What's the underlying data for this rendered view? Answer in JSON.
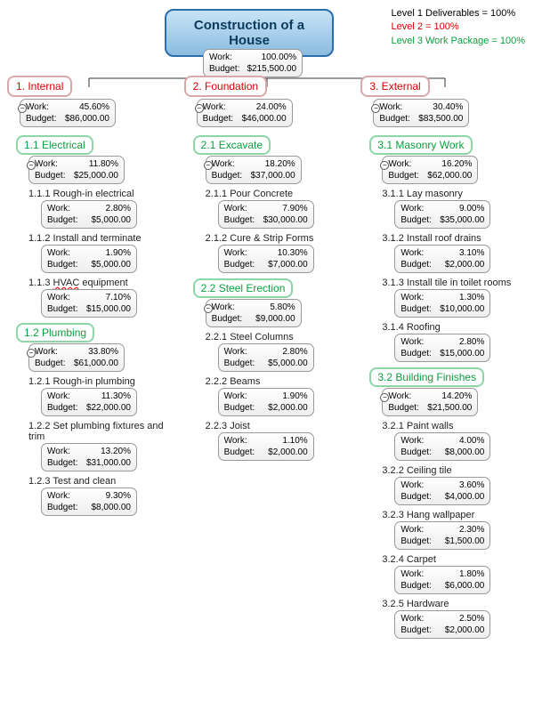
{
  "legend": {
    "l1": "Level 1 Deliverables = 100%",
    "l2": "Level 2 = 100%",
    "l3": "Level 3 Work Package = 100%"
  },
  "root": {
    "title": "Construction of a House",
    "work_label": "Work:",
    "work": "100.00%",
    "budget_label": "Budget:",
    "budget": "$215,500.00"
  },
  "cols": [
    {
      "n": "1. Internal",
      "work": "45.60%",
      "budget": "$86,000.00",
      "children": [
        {
          "n": "1.1 Electrical",
          "work": "11.80%",
          "budget": "$25,000.00",
          "items": [
            {
              "n": "1.1.1  Rough-in electrical",
              "work": "2.80%",
              "budget": "$5,000.00"
            },
            {
              "n": "1.1.2  Install and terminate",
              "work": "1.90%",
              "budget": "$5,000.00"
            },
            {
              "n": "1.1.3  HVAC equipment",
              "work": "7.10%",
              "budget": "$15,000.00",
              "squiggle": "HVAC"
            }
          ]
        },
        {
          "n": "1.2 Plumbing",
          "work": "33.80%",
          "budget": "$61,000.00",
          "items": [
            {
              "n": "1.2.1  Rough-in plumbing",
              "work": "11.30%",
              "budget": "$22,000.00"
            },
            {
              "n": "1.2.2  Set plumbing fixtures and trim",
              "work": "13.20%",
              "budget": "$31,000.00"
            },
            {
              "n": "1.2.3  Test and clean",
              "work": "9.30%",
              "budget": "$8,000.00"
            }
          ]
        }
      ]
    },
    {
      "n": "2. Foundation",
      "work": "24.00%",
      "budget": "$46,000.00",
      "children": [
        {
          "n": "2.1 Excavate",
          "work": "18.20%",
          "budget": "$37,000.00",
          "items": [
            {
              "n": "2.1.1  Pour Concrete",
              "work": "7.90%",
              "budget": "$30,000.00"
            },
            {
              "n": "2.1.2  Cure & Strip Forms",
              "work": "10.30%",
              "budget": "$7,000.00"
            }
          ]
        },
        {
          "n": "2.2 Steel Erection",
          "work": "5.80%",
          "budget": "$9,000.00",
          "items": [
            {
              "n": "2.2.1  Steel Columns",
              "work": "2.80%",
              "budget": "$5,000.00"
            },
            {
              "n": "2.2.2  Beams",
              "work": "1.90%",
              "budget": "$2,000.00"
            },
            {
              "n": "2.2.3  Joist",
              "work": "1.10%",
              "budget": "$2,000.00"
            }
          ]
        }
      ]
    },
    {
      "n": "3. External",
      "work": "30.40%",
      "budget": "$83,500.00",
      "children": [
        {
          "n": "3.1 Masonry Work",
          "work": "16.20%",
          "budget": "$62,000.00",
          "items": [
            {
              "n": "3.1.1  Lay masonry",
              "work": "9.00%",
              "budget": "$35,000.00"
            },
            {
              "n": "3.1.2  Install roof drains",
              "work": "3.10%",
              "budget": "$2,000.00"
            },
            {
              "n": "3.1.3  Install tile in toilet rooms",
              "work": "1.30%",
              "budget": "$10,000.00"
            },
            {
              "n": "3.1.4  Roofing",
              "work": "2.80%",
              "budget": "$15,000.00"
            }
          ]
        },
        {
          "n": "3.2 Building Finishes",
          "work": "14.20%",
          "budget": "$21,500.00",
          "items": [
            {
              "n": "3.2.1  Paint walls",
              "work": "4.00%",
              "budget": "$8,000.00"
            },
            {
              "n": "3.2.2  Ceiling tile",
              "work": "3.60%",
              "budget": "$4,000.00"
            },
            {
              "n": "3.2.3  Hang wallpaper",
              "work": "2.30%",
              "budget": "$1,500.00"
            },
            {
              "n": "3.2.4  Carpet",
              "work": "1.80%",
              "budget": "$6,000.00"
            },
            {
              "n": "3.2.5  Hardware",
              "work": "2.50%",
              "budget": "$2,000.00"
            }
          ]
        }
      ]
    }
  ]
}
